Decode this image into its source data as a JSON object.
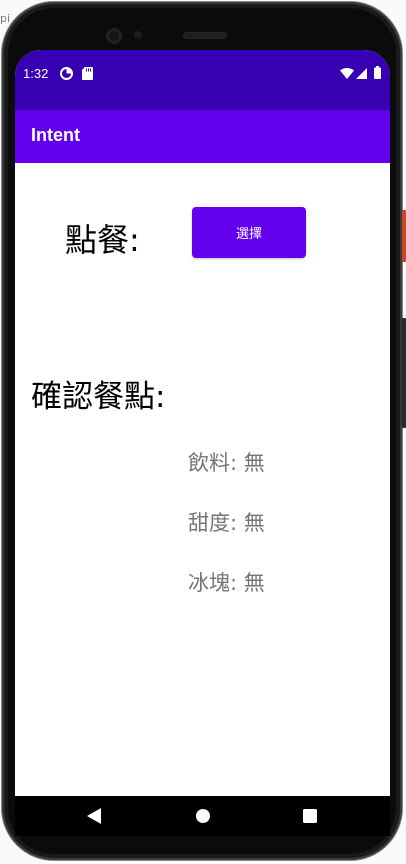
{
  "status_bar": {
    "time": "1:32",
    "icons": [
      "data-saver-icon",
      "sd-card-icon",
      "wifi-icon",
      "signal-icon",
      "battery-icon"
    ],
    "color": "#3700b3"
  },
  "app_bar": {
    "title": "Intent",
    "color": "#6200ee"
  },
  "order": {
    "label": "點餐:",
    "button_label": "選擇"
  },
  "confirm": {
    "label": "確認餐點:",
    "drink": "飲料: 無",
    "sweetness": "甜度: 無",
    "ice": "冰塊: 無"
  },
  "nav_bar": {
    "icons": [
      "back-icon",
      "home-icon",
      "recents-icon"
    ]
  }
}
